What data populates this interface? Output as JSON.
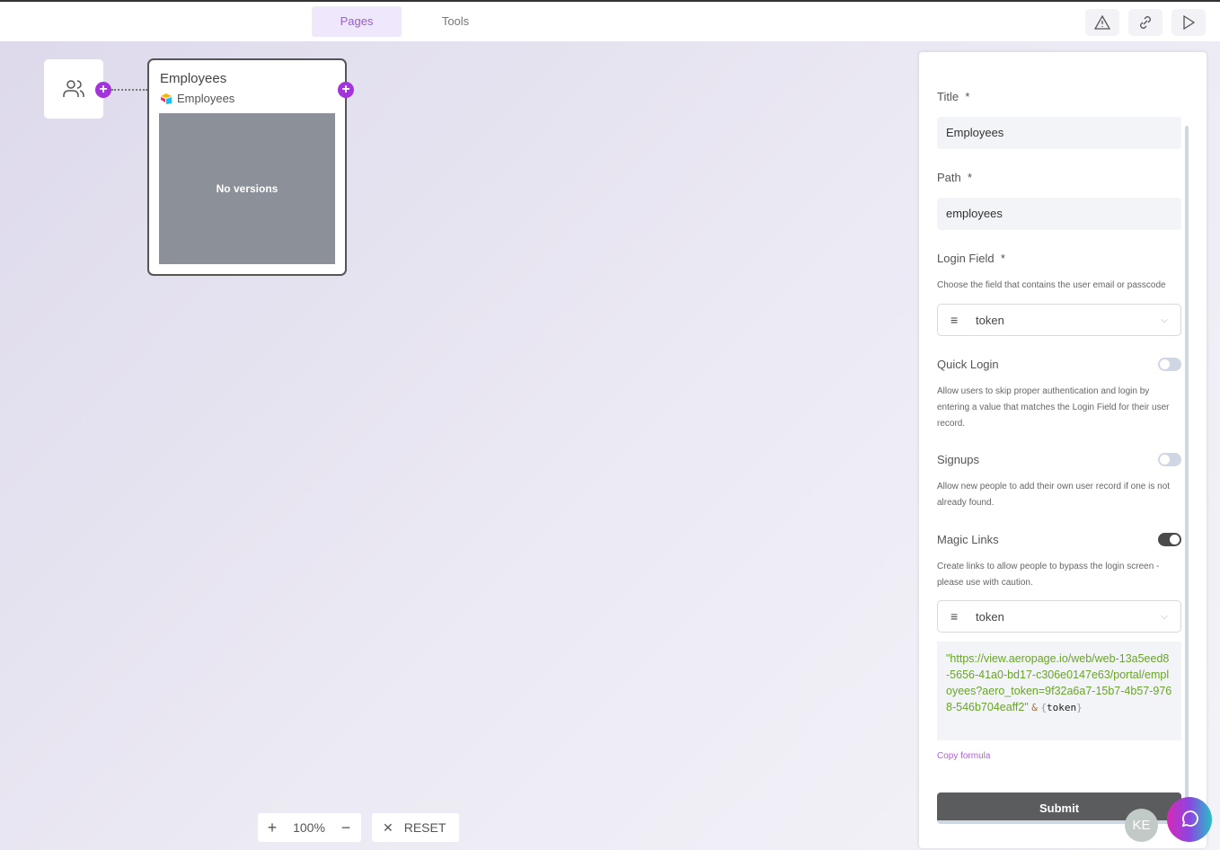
{
  "topbar": {
    "tabs": [
      {
        "label": "Pages",
        "active": true
      },
      {
        "label": "Tools",
        "active": false
      }
    ],
    "icons": [
      "warning-icon",
      "link-icon",
      "play-icon"
    ]
  },
  "canvas": {
    "users_node_icon": "users-icon",
    "card": {
      "title": "Employees",
      "source": "Employees",
      "preview_text": "No versions"
    },
    "zoom": {
      "level": "100%",
      "reset": "RESET"
    }
  },
  "panel": {
    "title_label": "Title",
    "title_value": "Employees",
    "path_label": "Path",
    "path_value": "employees",
    "login_label": "Login Field",
    "login_help": "Choose the field that contains the user email or passcode",
    "login_value": "token",
    "quick_label": "Quick Login",
    "quick_on": false,
    "quick_help": "Allow users to skip proper authentication and login by entering a value that matches the Login Field for their user record.",
    "signups_label": "Signups",
    "signups_on": false,
    "signups_help": "Allow new people to add their own user record if one is not already found.",
    "magic_label": "Magic Links",
    "magic_on": true,
    "magic_help": "Create links to allow people to bypass the login screen - please use with caution.",
    "magic_value": "token",
    "formula_string": "\"https://view.aeropage.io/web/web-13a5eed8-5656-41a0-bd17-c306e0147e63/portal/employees?aero_token=9f32a6a7-15b7-4b57-9768-546b704eaff2\"",
    "formula_amp": "&",
    "formula_field": "token",
    "copy": "Copy formula",
    "submit": "Submit",
    "required": "*"
  },
  "user": {
    "initials": "KE"
  },
  "colors": {
    "accent": "#a233dd",
    "formula": "#6aa32c"
  }
}
